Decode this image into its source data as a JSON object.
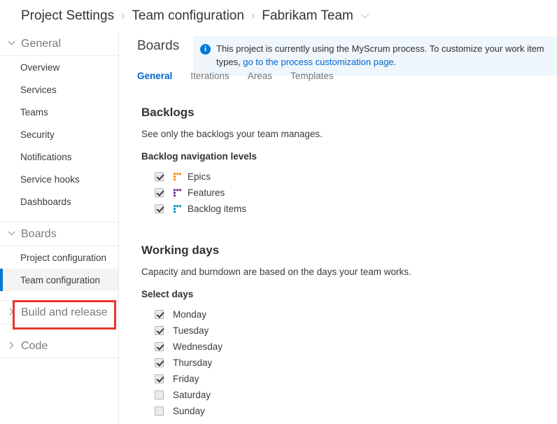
{
  "breadcrumb": {
    "items": [
      "Project Settings",
      "Team configuration",
      "Fabrikam Team"
    ],
    "separator": "›",
    "chevron": "⌄"
  },
  "sidebar": {
    "sections": [
      {
        "label": "General",
        "state": "expanded",
        "chevron": "⌄",
        "items": [
          {
            "label": "Overview",
            "selected": false
          },
          {
            "label": "Services",
            "selected": false
          },
          {
            "label": "Teams",
            "selected": false
          },
          {
            "label": "Security",
            "selected": false
          },
          {
            "label": "Notifications",
            "selected": false
          },
          {
            "label": "Service hooks",
            "selected": false
          },
          {
            "label": "Dashboards",
            "selected": false
          }
        ]
      },
      {
        "label": "Boards",
        "state": "expanded",
        "chevron": "⌄",
        "items": [
          {
            "label": "Project configuration",
            "selected": false
          },
          {
            "label": "Team configuration",
            "selected": true
          }
        ]
      },
      {
        "label": "Build and release",
        "state": "collapsed",
        "chevron": "›",
        "items": []
      },
      {
        "label": "Code",
        "state": "collapsed",
        "chevron": "›",
        "items": []
      }
    ],
    "selected_accent_color": "#0078d4",
    "annotation_color": "#e8352a"
  },
  "main": {
    "page_title": "Boards",
    "banner": {
      "icon": "info-icon",
      "text_before_link": "This project is currently using the MyScrum process. To customize your work item types, ",
      "link_text": "go to the process customization page",
      "text_after_link": ".",
      "background_color": "#eff6fc",
      "icon_color": "#0078d4"
    },
    "tabs": [
      {
        "label": "General",
        "active": true
      },
      {
        "label": "Iterations",
        "active": false
      },
      {
        "label": "Areas",
        "active": false
      },
      {
        "label": "Templates",
        "active": false
      }
    ],
    "backlogs": {
      "title": "Backlogs",
      "description": "See only the backlogs your team manages.",
      "subtitle": "Backlog navigation levels",
      "levels": [
        {
          "label": "Epics",
          "checked": true,
          "icon": "work-item-level-icon",
          "color": "#ff8c00"
        },
        {
          "label": "Features",
          "checked": true,
          "icon": "work-item-level-icon",
          "color": "#773b93"
        },
        {
          "label": "Backlog items",
          "checked": true,
          "icon": "work-item-level-icon",
          "color": "#009ccc"
        }
      ]
    },
    "working_days": {
      "title": "Working days",
      "description": "Capacity and burndown are based on the days your team works.",
      "subtitle": "Select days",
      "days": [
        {
          "label": "Monday",
          "checked": true
        },
        {
          "label": "Tuesday",
          "checked": true
        },
        {
          "label": "Wednesday",
          "checked": true
        },
        {
          "label": "Thursday",
          "checked": true
        },
        {
          "label": "Friday",
          "checked": true
        },
        {
          "label": "Saturday",
          "checked": false
        },
        {
          "label": "Sunday",
          "checked": false
        }
      ]
    }
  }
}
